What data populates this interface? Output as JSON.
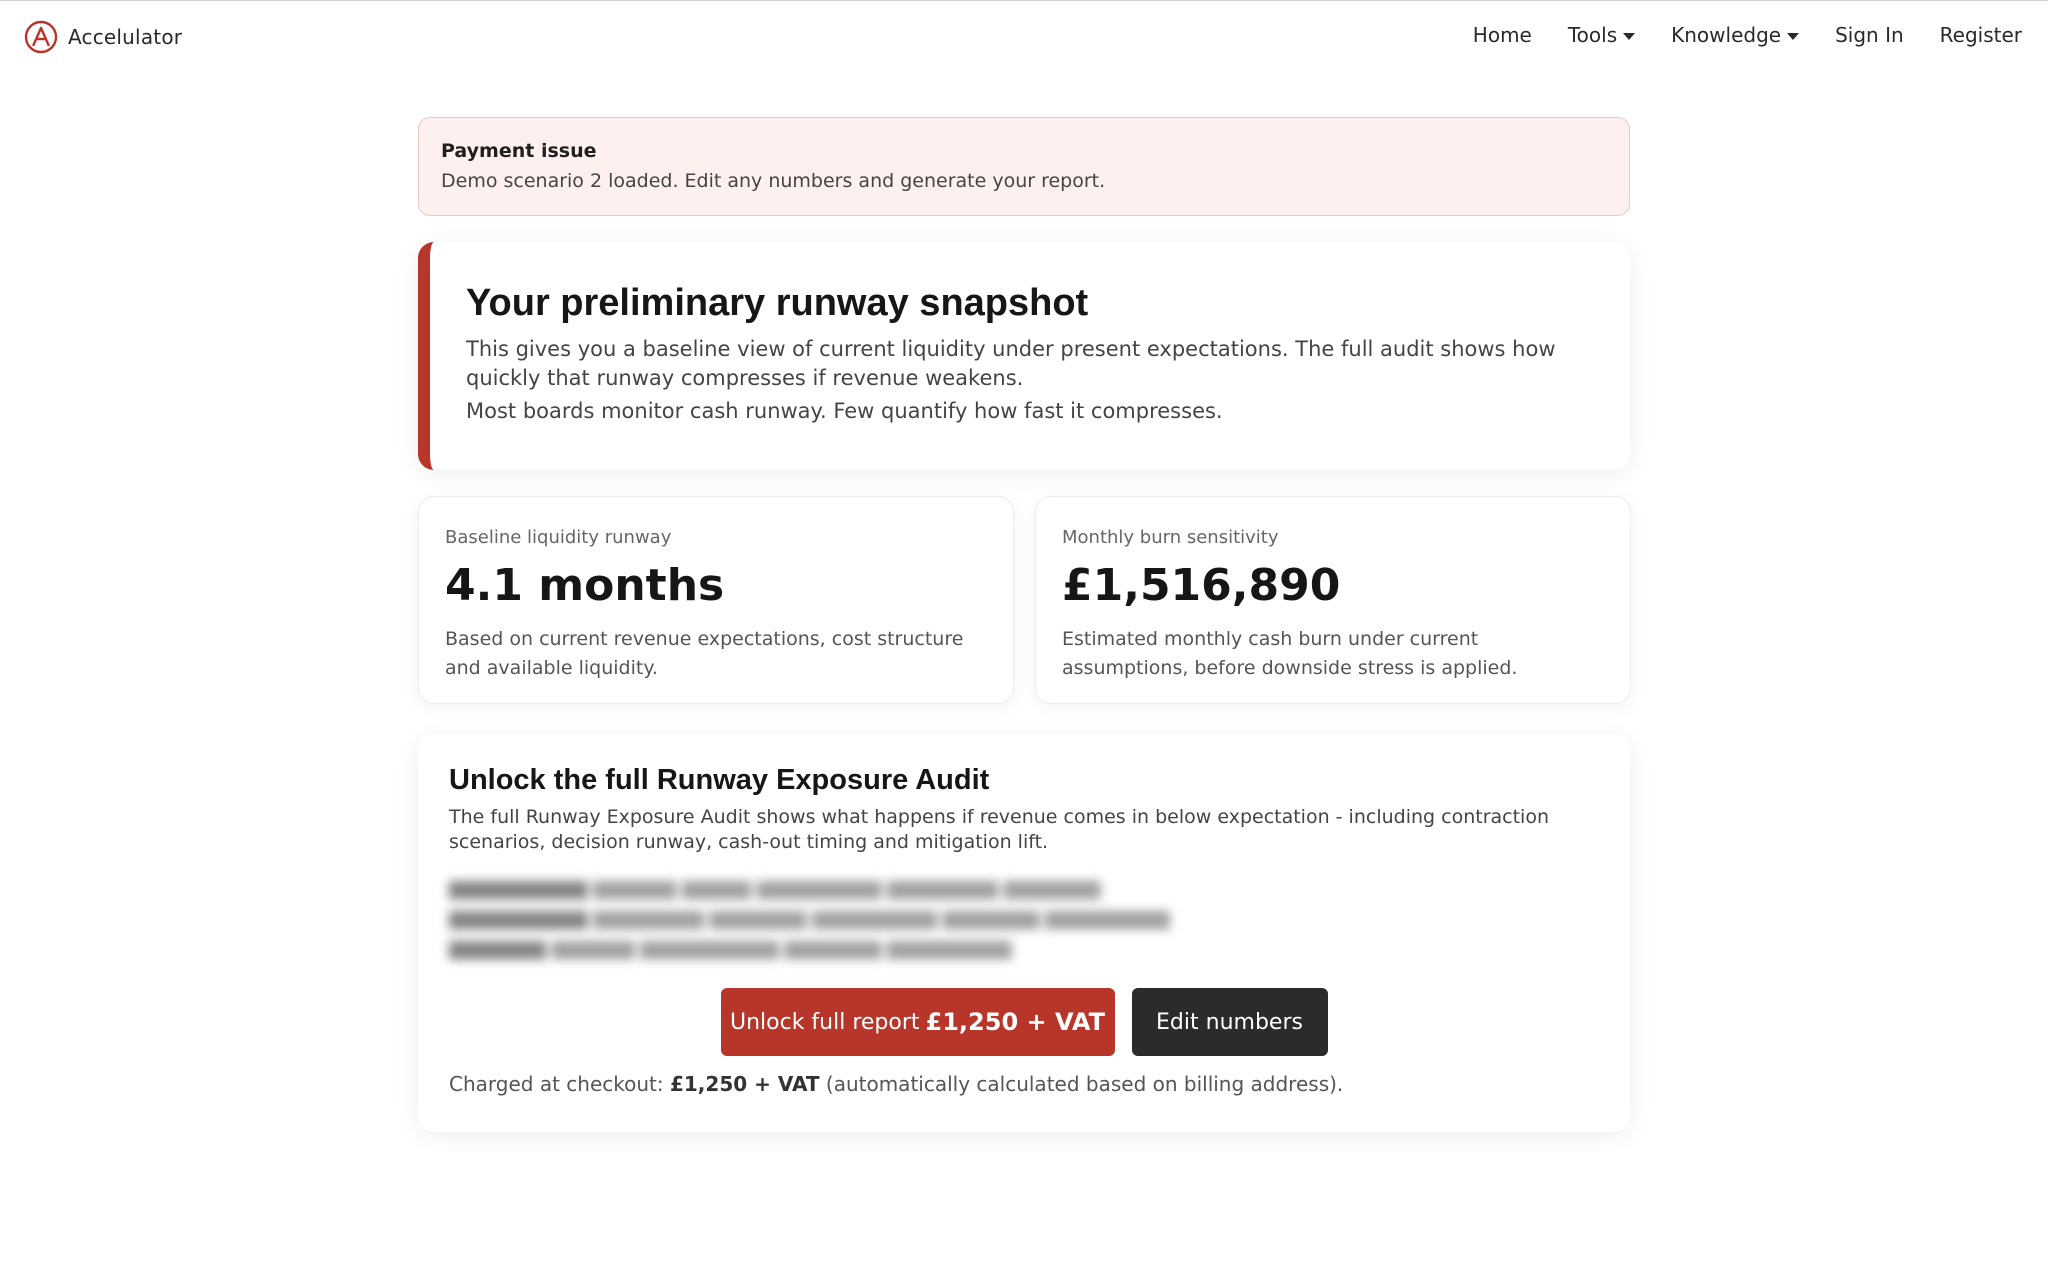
{
  "brand": {
    "name": "Accelulator",
    "logo_letter": "A",
    "accent": "#b8352a"
  },
  "nav": {
    "items": [
      {
        "label": "Home",
        "dropdown": false
      },
      {
        "label": "Tools",
        "dropdown": true
      },
      {
        "label": "Knowledge",
        "dropdown": true
      },
      {
        "label": "Sign In",
        "dropdown": false
      },
      {
        "label": "Register",
        "dropdown": false
      }
    ]
  },
  "alert": {
    "title": "Payment issue",
    "text": "Demo scenario 2 loaded. Edit any numbers and generate your report."
  },
  "snapshot": {
    "title": "Your preliminary runway snapshot",
    "p1": "This gives you a baseline view of current liquidity under present expectations. The full audit shows how quickly that runway compresses if revenue weakens.",
    "p2": "Most boards monitor cash runway. Few quantify how fast it compresses."
  },
  "metrics": [
    {
      "label": "Baseline liquidity runway",
      "value": "4.1 months",
      "desc": "Based on current revenue expectations, cost structure and available liquidity."
    },
    {
      "label": "Monthly burn sensitivity",
      "value": "£1,516,890",
      "desc": "Estimated monthly cash burn under current assumptions, before downside stress is applied."
    }
  ],
  "unlock": {
    "title": "Unlock the full Runway Exposure Audit",
    "text": "The full Runway Exposure Audit shows what happens if revenue comes in below expectation - including contraction scenarios, decision runway, cash-out timing and mitigation lift.",
    "primary_label": "Unlock full report",
    "primary_price": "£1,250 + VAT",
    "secondary_label": "Edit numbers",
    "charged_prefix": "Charged at checkout:",
    "charged_price": "£1,250 + VAT",
    "charged_suffix": "(automatically calculated based on billing address)."
  }
}
